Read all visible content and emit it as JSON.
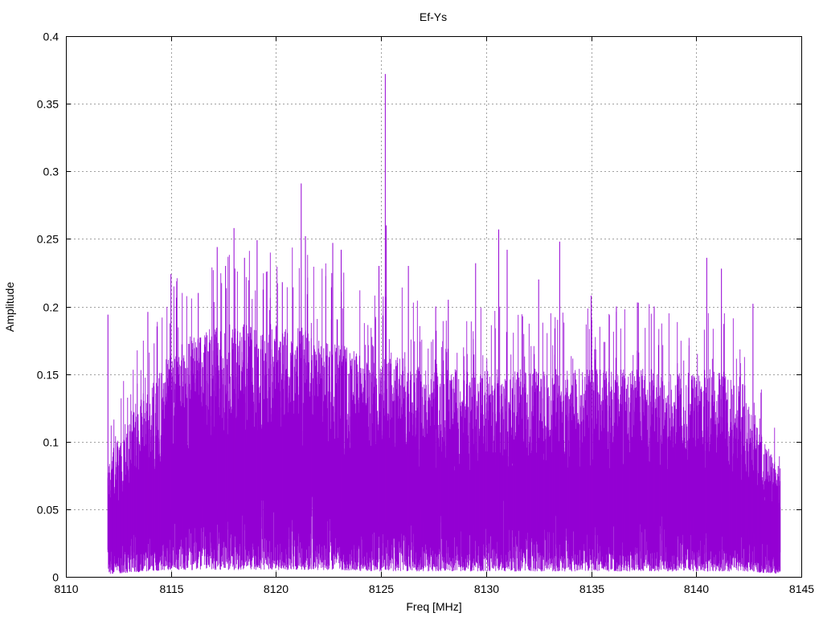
{
  "chart_data": {
    "type": "line",
    "title": "Ef-Ys",
    "xlabel": "Freq [MHz]",
    "ylabel": "Amplitude",
    "xlim": [
      8110,
      8145
    ],
    "ylim": [
      0,
      0.4
    ],
    "grid": true,
    "legend": "none",
    "xticks": [
      8110,
      8115,
      8120,
      8125,
      8130,
      8135,
      8140,
      8145
    ],
    "xtick_labels": [
      "8110",
      "8115",
      "8120",
      "8125",
      "8130",
      "8135",
      "8140",
      "8145"
    ],
    "yticks": [
      0,
      0.05,
      0.1,
      0.15,
      0.2,
      0.25,
      0.3,
      0.35,
      0.4
    ],
    "ytick_labels": [
      "0",
      "0.05",
      "0.1",
      "0.15",
      "0.2",
      "0.25",
      "0.3",
      "0.35",
      "0.4"
    ],
    "series": [
      {
        "name": "Ef-Ys",
        "color": "#9400d3",
        "x_range": [
          8112.0,
          8144.0
        ],
        "envelope_x": [
          8112,
          8113,
          8114,
          8115,
          8116,
          8117,
          8118,
          8119,
          8120,
          8121,
          8122,
          8123,
          8124,
          8125,
          8126,
          8127,
          8128,
          8129,
          8130,
          8131,
          8132,
          8133,
          8134,
          8135,
          8136,
          8137,
          8138,
          8139,
          8140,
          8141,
          8142,
          8143,
          8144
        ],
        "envelope_upper": [
          0.08,
          0.11,
          0.13,
          0.15,
          0.16,
          0.17,
          0.17,
          0.17,
          0.17,
          0.17,
          0.16,
          0.16,
          0.15,
          0.15,
          0.15,
          0.14,
          0.14,
          0.14,
          0.14,
          0.14,
          0.14,
          0.14,
          0.14,
          0.14,
          0.14,
          0.14,
          0.14,
          0.14,
          0.14,
          0.14,
          0.13,
          0.1,
          0.07
        ],
        "envelope_lower": [
          0.02,
          0.03,
          0.04,
          0.05,
          0.05,
          0.05,
          0.05,
          0.05,
          0.05,
          0.05,
          0.05,
          0.05,
          0.04,
          0.04,
          0.04,
          0.04,
          0.04,
          0.04,
          0.04,
          0.04,
          0.04,
          0.04,
          0.04,
          0.04,
          0.04,
          0.04,
          0.04,
          0.04,
          0.04,
          0.04,
          0.04,
          0.03,
          0.02
        ],
        "peaks": [
          {
            "x": 8112.0,
            "y": 0.194
          },
          {
            "x": 8113.9,
            "y": 0.196
          },
          {
            "x": 8115.0,
            "y": 0.224
          },
          {
            "x": 8116.3,
            "y": 0.21
          },
          {
            "x": 8117.2,
            "y": 0.244
          },
          {
            "x": 8117.6,
            "y": 0.23
          },
          {
            "x": 8118.0,
            "y": 0.258
          },
          {
            "x": 8118.5,
            "y": 0.236
          },
          {
            "x": 8119.1,
            "y": 0.249
          },
          {
            "x": 8120.3,
            "y": 0.218
          },
          {
            "x": 8121.2,
            "y": 0.291
          },
          {
            "x": 8121.4,
            "y": 0.252
          },
          {
            "x": 8122.7,
            "y": 0.247
          },
          {
            "x": 8123.1,
            "y": 0.242
          },
          {
            "x": 8124.9,
            "y": 0.23
          },
          {
            "x": 8125.2,
            "y": 0.372
          },
          {
            "x": 8125.25,
            "y": 0.26
          },
          {
            "x": 8126.3,
            "y": 0.23
          },
          {
            "x": 8127.6,
            "y": 0.2
          },
          {
            "x": 8128.2,
            "y": 0.205
          },
          {
            "x": 8129.5,
            "y": 0.232
          },
          {
            "x": 8130.6,
            "y": 0.257
          },
          {
            "x": 8131.0,
            "y": 0.242
          },
          {
            "x": 8132.5,
            "y": 0.22
          },
          {
            "x": 8133.5,
            "y": 0.248
          },
          {
            "x": 8135.0,
            "y": 0.208
          },
          {
            "x": 8136.2,
            "y": 0.2
          },
          {
            "x": 8137.2,
            "y": 0.203
          },
          {
            "x": 8138.0,
            "y": 0.2
          },
          {
            "x": 8140.5,
            "y": 0.236
          },
          {
            "x": 8141.2,
            "y": 0.228
          },
          {
            "x": 8142.7,
            "y": 0.202
          },
          {
            "x": 8143.9,
            "y": 0.082
          }
        ]
      }
    ]
  }
}
